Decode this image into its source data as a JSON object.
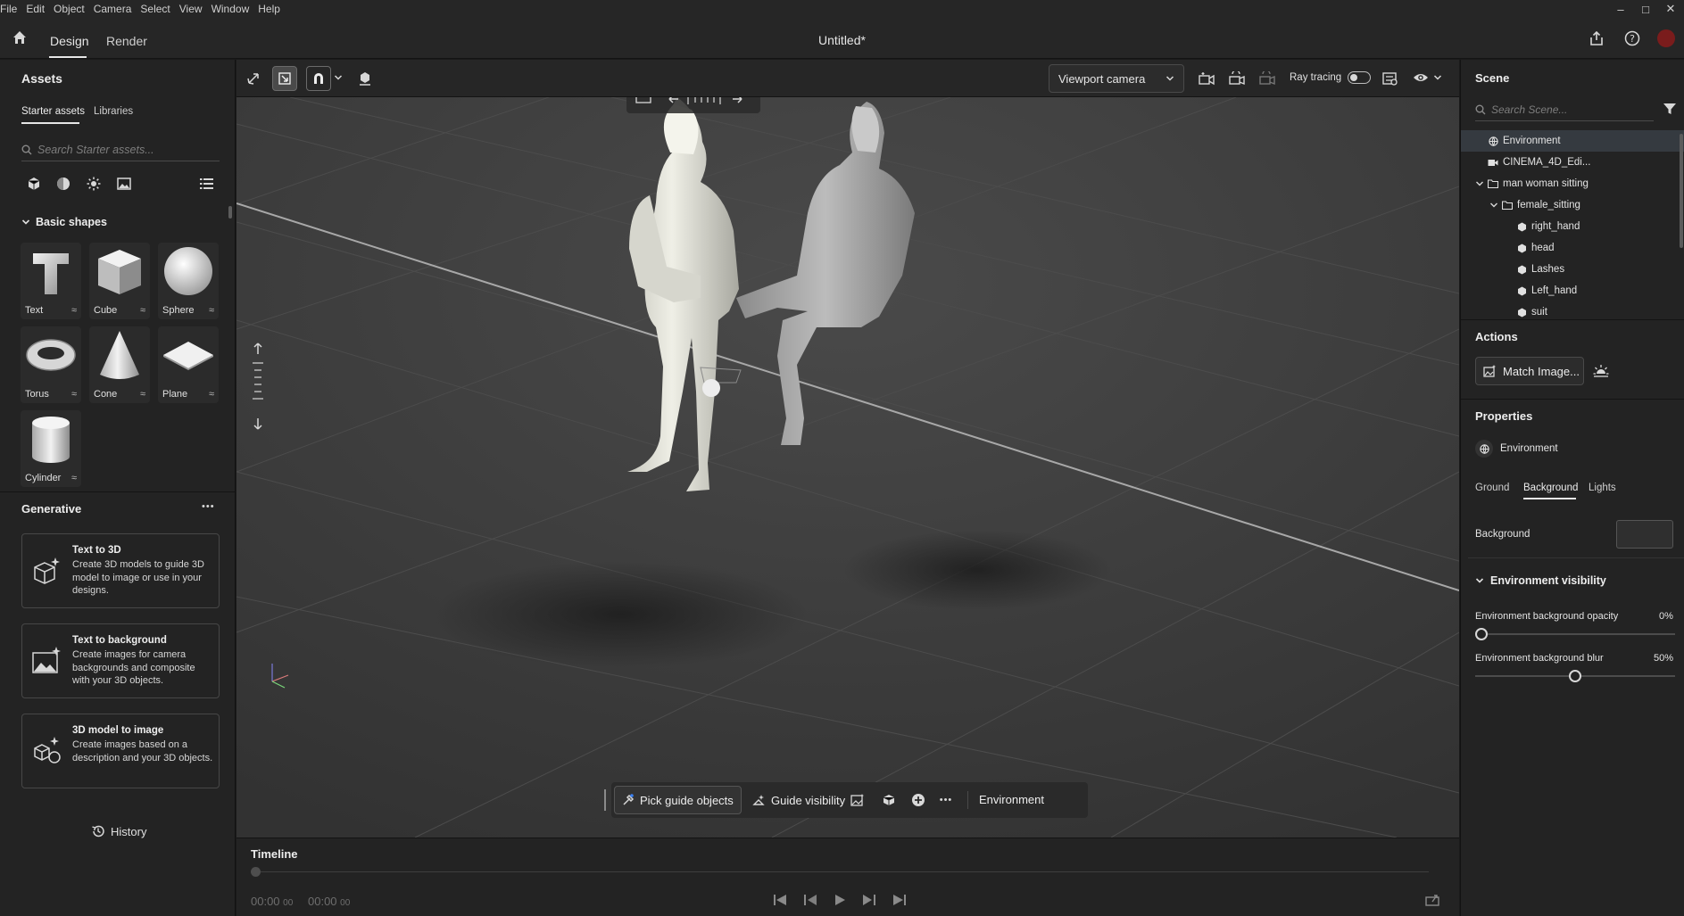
{
  "menu": [
    "File",
    "Edit",
    "Object",
    "Camera",
    "Select",
    "View",
    "Window",
    "Help"
  ],
  "window_controls": [
    "–",
    "□",
    "✕"
  ],
  "app_tabs": {
    "design": "Design",
    "render": "Render"
  },
  "document_title": "Untitled*",
  "assets": {
    "title": "Assets",
    "tabs": [
      "Starter assets",
      "Libraries"
    ],
    "search_placeholder": "Search Starter assets...",
    "section_title": "Basic shapes",
    "shapes": [
      "Text",
      "Cube",
      "Sphere",
      "Torus",
      "Cone",
      "Plane",
      "Cylinder"
    ]
  },
  "generative": {
    "title": "Generative",
    "more": "•••",
    "cards": [
      {
        "title": "Text to 3D",
        "desc": "Create 3D models to guide 3D model to image or use in your designs."
      },
      {
        "title": "Text to background",
        "desc": "Create images for camera backgrounds and composite with your 3D objects."
      },
      {
        "title": "3D model to image",
        "desc": "Create images based on a description and your 3D objects."
      }
    ],
    "history": "History"
  },
  "viewport_toolbar": {
    "camera": "Viewport camera",
    "ray_tracing": "Ray tracing",
    "ray_tracing_on": false
  },
  "bottom_toolbar": {
    "pick": "Pick guide objects",
    "visibility": "Guide visibility",
    "environment": "Environment"
  },
  "timeline": {
    "title": "Timeline",
    "time_start": "00:00",
    "time_start_frames": "00",
    "time_end": "00:00",
    "time_end_frames": "00"
  },
  "scene": {
    "title": "Scene",
    "search_placeholder": "Search Scene...",
    "items": [
      {
        "label": "Environment",
        "icon": "globe-icon",
        "selected": true
      },
      {
        "label": "CINEMA_4D_Edi...",
        "icon": "camera-icon"
      },
      {
        "label": "man woman sitting",
        "icon": "folder-icon",
        "expand": true
      },
      {
        "label": "female_sitting",
        "icon": "folder-icon",
        "expand": true
      },
      {
        "label": "right_hand",
        "icon": "mesh-icon"
      },
      {
        "label": "head",
        "icon": "mesh-icon"
      },
      {
        "label": "Lashes",
        "icon": "mesh-icon"
      },
      {
        "label": "Left_hand",
        "icon": "mesh-icon"
      },
      {
        "label": "suit",
        "icon": "mesh-icon"
      }
    ]
  },
  "actions": {
    "title": "Actions",
    "match_image": "Match Image..."
  },
  "properties": {
    "title": "Properties",
    "object": "Environment",
    "tabs": [
      "Ground",
      "Background",
      "Lights"
    ],
    "active_tab": 1,
    "background_label": "Background",
    "env_visibility_title": "Environment visibility",
    "opacity_label": "Environment background opacity",
    "opacity_value": "0%",
    "opacity_fraction": 0,
    "blur_label": "Environment background blur",
    "blur_value": "50%",
    "blur_fraction": 0.5
  },
  "colors": {
    "accent": "#e6e6e6",
    "panel": "#232323",
    "viewport": "#3a3a3a",
    "selected": "#353a40"
  }
}
